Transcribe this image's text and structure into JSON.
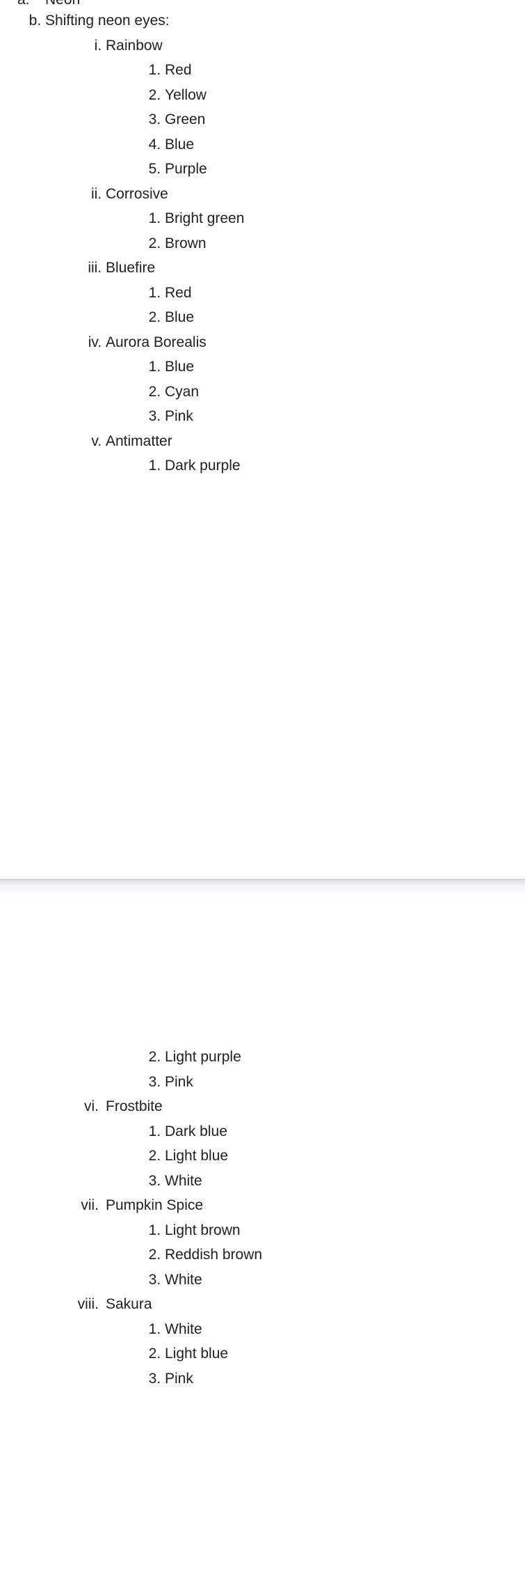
{
  "document": {
    "clipped_top_line": {
      "marker": "a.",
      "label": "Neon"
    },
    "section": {
      "marker": "b.",
      "label": "Shifting neon eyes:"
    },
    "variants": [
      {
        "marker": "i.",
        "name": "Rainbow",
        "colors": [
          "Red",
          "Yellow",
          "Green",
          "Blue",
          "Purple"
        ]
      },
      {
        "marker": "ii.",
        "name": "Corrosive",
        "colors": [
          "Bright green",
          "Brown"
        ]
      },
      {
        "marker": "iii.",
        "name": "Bluefire",
        "colors": [
          "Red",
          "Blue"
        ]
      },
      {
        "marker": "iv.",
        "name": "Aurora Borealis",
        "colors": [
          "Blue",
          "Cyan",
          "Pink"
        ]
      },
      {
        "marker": "v.",
        "name": "Antimatter",
        "colors": [
          "Dark purple",
          "Light purple",
          "Pink"
        ]
      },
      {
        "marker": "vi.",
        "name": "Frostbite",
        "colors": [
          "Dark blue",
          "Light blue",
          "White"
        ]
      },
      {
        "marker": "vii.",
        "name": "Pumpkin Spice",
        "colors": [
          "Light brown",
          "Reddish brown",
          "White"
        ]
      },
      {
        "marker": "viii.",
        "name": "Sakura",
        "colors": [
          "White",
          "Light blue",
          "Pink"
        ]
      }
    ],
    "page_one": {
      "antimatter_colors_shown": [
        "Dark purple"
      ]
    },
    "page_two": {
      "antimatter_colors_continued": [
        "Light purple",
        "Pink"
      ],
      "continued_start_number": 2
    }
  },
  "style": {
    "text_color": "#202124",
    "page_background": "#ffffff",
    "page_break_color": "#f1f2f3",
    "page_break_border": "#cfd0d2"
  }
}
